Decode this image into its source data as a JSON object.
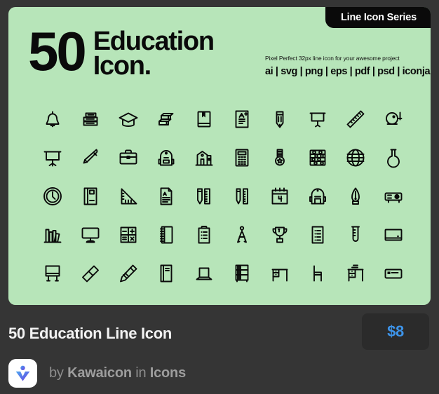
{
  "card": {
    "series_badge": "Line Icon Series",
    "headline_count": "50",
    "headline_line1": "Education",
    "headline_line2": "Icon.",
    "tagline": "Pixel Perfect 32px line icon for your awesome project",
    "formats": "ai | svg | png | eps | pdf | psd | iconjar",
    "background_color": "#b7e5b9",
    "ink_color": "#0a0a0a"
  },
  "icons": [
    {
      "name": "bell-icon"
    },
    {
      "name": "stacked-books-icon"
    },
    {
      "name": "graduation-cap-icon"
    },
    {
      "name": "eraser-blocks-icon"
    },
    {
      "name": "bookmarked-book-icon"
    },
    {
      "name": "graded-paper-icon"
    },
    {
      "name": "pencil-icon"
    },
    {
      "name": "projector-screen-icon"
    },
    {
      "name": "ruler-icon"
    },
    {
      "name": "school-bell-icon"
    },
    {
      "name": "whiteboard-stand-icon"
    },
    {
      "name": "pen-icon"
    },
    {
      "name": "briefcase-icon"
    },
    {
      "name": "backpack-icon"
    },
    {
      "name": "school-building-icon"
    },
    {
      "name": "calculator-icon"
    },
    {
      "name": "medal-icon"
    },
    {
      "name": "abacus-icon"
    },
    {
      "name": "globe-icon"
    },
    {
      "name": "flask-icon"
    },
    {
      "name": "wall-clock-icon"
    },
    {
      "name": "notebook-icon"
    },
    {
      "name": "triangle-ruler-icon"
    },
    {
      "name": "document-a-icon"
    },
    {
      "name": "pencil-ruler-icon"
    },
    {
      "name": "pen-ruler-icon"
    },
    {
      "name": "calendar-icon"
    },
    {
      "name": "school-bag-icon"
    },
    {
      "name": "fountain-pen-nib-icon"
    },
    {
      "name": "projector-icon"
    },
    {
      "name": "bookshelf-icon"
    },
    {
      "name": "monitor-icon"
    },
    {
      "name": "math-symbols-icon"
    },
    {
      "name": "spiral-notebook-icon"
    },
    {
      "name": "clipboard-icon"
    },
    {
      "name": "compass-divider-icon"
    },
    {
      "name": "trophy-icon"
    },
    {
      "name": "checklist-document-icon"
    },
    {
      "name": "test-tube-icon"
    },
    {
      "name": "whiteboard-icon"
    },
    {
      "name": "easel-board-icon"
    },
    {
      "name": "eraser-icon"
    },
    {
      "name": "pencil-diagonal-icon"
    },
    {
      "name": "closed-book-icon"
    },
    {
      "name": "laptop-icon"
    },
    {
      "name": "bookcase-icon"
    },
    {
      "name": "study-desk-icon"
    },
    {
      "name": "chair-icon"
    },
    {
      "name": "desk-drawers-icon"
    },
    {
      "name": "id-card-icon"
    }
  ],
  "footer": {
    "title": "50 Education Line Icon",
    "price": "$8",
    "by_label": "by",
    "author": "Kawaicon",
    "in_label": "in",
    "category": "Icons",
    "price_color": "#3d93e8",
    "avatar_icon": "kawaicon-logo-icon"
  }
}
